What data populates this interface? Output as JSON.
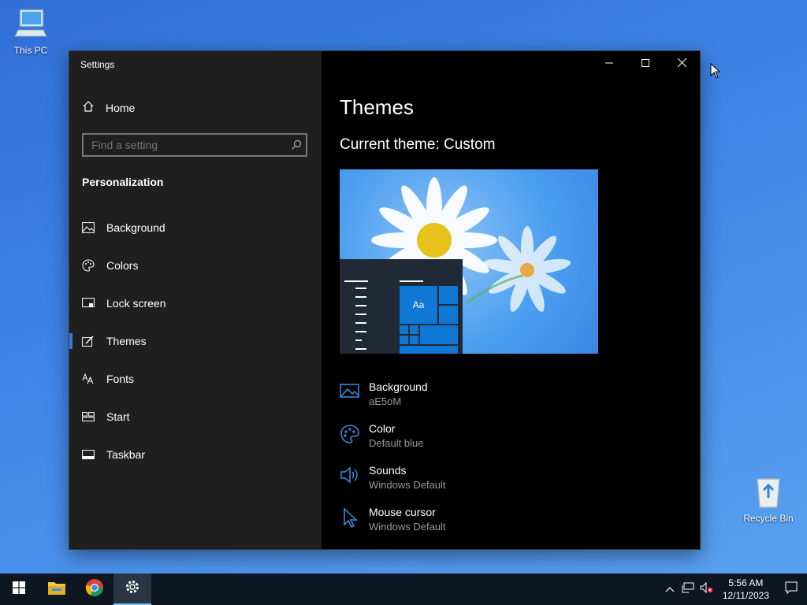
{
  "desktop": {
    "icons": [
      {
        "label": "This PC"
      },
      {
        "label": "Recycle Bin"
      }
    ]
  },
  "window": {
    "title": "Settings",
    "controls": {
      "minimize": "minimize",
      "maximize": "maximize",
      "close": "close"
    }
  },
  "sidebar": {
    "home_label": "Home",
    "search_placeholder": "Find a setting",
    "section_title": "Personalization",
    "items": [
      {
        "label": "Background",
        "icon": "image-icon"
      },
      {
        "label": "Colors",
        "icon": "palette-icon"
      },
      {
        "label": "Lock screen",
        "icon": "lock-screen-icon"
      },
      {
        "label": "Themes",
        "icon": "themes-icon",
        "active": true
      },
      {
        "label": "Fonts",
        "icon": "fonts-icon"
      },
      {
        "label": "Start",
        "icon": "start-icon"
      },
      {
        "label": "Taskbar",
        "icon": "taskbar-icon"
      }
    ]
  },
  "main": {
    "title": "Themes",
    "current_theme": "Current theme: Custom",
    "preview_tile_label": "Aa",
    "properties": [
      {
        "label": "Background",
        "value": "aE5oM",
        "icon": "image-icon"
      },
      {
        "label": "Color",
        "value": "Default blue",
        "icon": "palette-icon"
      },
      {
        "label": "Sounds",
        "value": "Windows Default",
        "icon": "speaker-icon"
      },
      {
        "label": "Mouse cursor",
        "value": "Windows Default",
        "icon": "cursor-icon"
      }
    ]
  },
  "taskbar": {
    "time": "5:56 AM",
    "date": "12/11/2023"
  },
  "colors": {
    "accent": "#0f78d4",
    "sidebar_bg": "#1f1f1f",
    "content_bg": "#000000",
    "taskbar_bg": "#0e1621"
  }
}
